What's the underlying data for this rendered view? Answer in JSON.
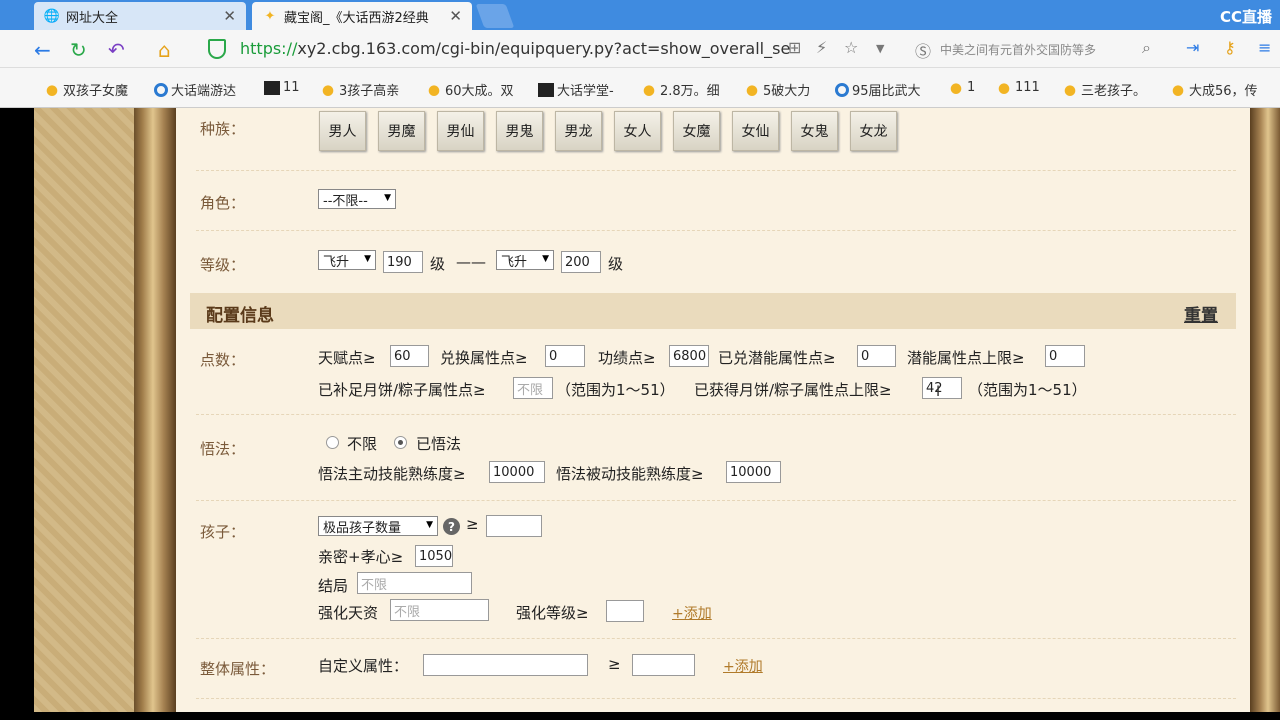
{
  "tabs": [
    {
      "title": "网址大全",
      "icon": "globe-icon",
      "active": false
    },
    {
      "title": "藏宝阁_《大话西游2经典",
      "icon": "cbg-icon",
      "active": true
    }
  ],
  "cc_logo": "CC直播",
  "address": {
    "protocol": "https://",
    "rest": "xy2.cbg.163.com/cgi-bin/equipquery.py?act=show_overall_se",
    "search_text": "中美之间有元首外交国防等多"
  },
  "bookmarks": [
    {
      "label": "双孩子女魔",
      "icon": "star"
    },
    {
      "label": "大话端游达",
      "icon": "blue"
    },
    {
      "label": "11",
      "icon": "dark"
    },
    {
      "label": "3孩子高亲",
      "icon": "star"
    },
    {
      "label": "60大成。双",
      "icon": "star"
    },
    {
      "label": "大话学堂-",
      "icon": "dark"
    },
    {
      "label": "2.8万。细",
      "icon": "star"
    },
    {
      "label": "5破大力",
      "icon": "star"
    },
    {
      "label": "95届比武大",
      "icon": "blue"
    },
    {
      "label": "1",
      "icon": "star"
    },
    {
      "label": "111",
      "icon": "star"
    },
    {
      "label": "三老孩子。",
      "icon": "star"
    },
    {
      "label": "大成56，传",
      "icon": "star"
    }
  ],
  "form": {
    "race_label": "种族：",
    "races": [
      "男人",
      "男魔",
      "男仙",
      "男鬼",
      "男龙",
      "女人",
      "女魔",
      "女仙",
      "女鬼",
      "女龙"
    ],
    "role_label": "角色：",
    "role_value": "--不限--",
    "level_label": "等级：",
    "level_from_type": "飞升",
    "level_from": "190",
    "level_unit": "级",
    "level_dash": "——",
    "level_to_type": "飞升",
    "level_to": "200",
    "section_title": "配置信息",
    "reset": "重置",
    "points_label": "点数：",
    "talent_label": "天赋点≥",
    "talent_value": "60",
    "exchange_label": "兑换属性点≥",
    "exchange_value": "0",
    "merit_label": "功绩点≥",
    "merit_value": "6800",
    "potential_label": "已兑潜能属性点≥",
    "potential_value": "0",
    "potential_max_label": "潜能属性点上限≥",
    "potential_max_value": "0",
    "mooncake_label": "已补足月饼/粽子属性点≥",
    "mooncake_placeholder": "不限",
    "range_note": "（范围为1～51）",
    "mooncake_max_label": "已获得月饼/粽子属性点上限≥",
    "mooncake_max_value": "42",
    "wufa_label": "悟法：",
    "wufa_opt1": "不限",
    "wufa_opt2": "已悟法",
    "wufa_active_label": "悟法主动技能熟练度≥",
    "wufa_active_value": "10000",
    "wufa_passive_label": "悟法被动技能熟练度≥",
    "wufa_passive_value": "10000",
    "child_label": "孩子：",
    "child_select": "极品孩子数量",
    "help": "?",
    "gte": "≥",
    "intimacy_label": "亲密+孝心≥",
    "intimacy_value": "1050",
    "ending_label": "结局",
    "ending_placeholder": "不限",
    "talent_child_label": "强化天资",
    "talent_child_placeholder": "不限",
    "enhance_label": "强化等级≥",
    "add_link": "+添加",
    "overall_label": "整体属性：",
    "custom_label": "自定义属性："
  }
}
